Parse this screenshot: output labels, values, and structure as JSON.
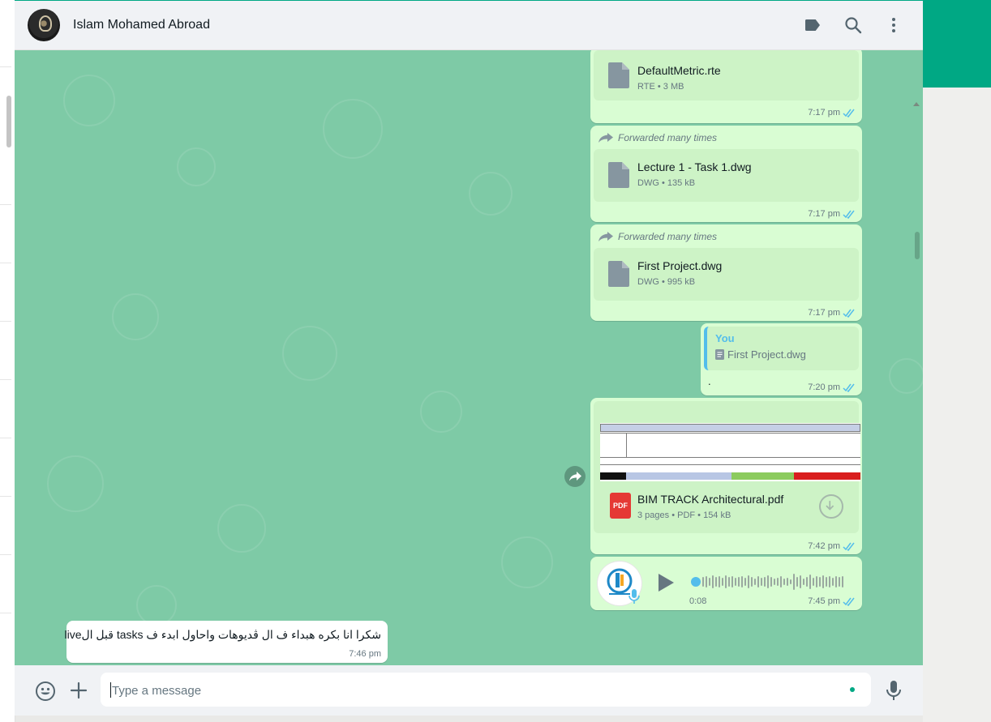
{
  "header": {
    "contact_name": "Islam Mohamed Abroad",
    "icons": [
      "label-icon",
      "search-icon",
      "menu-icon"
    ]
  },
  "messages": [
    {
      "type": "document",
      "direction": "out",
      "file_name": "DefaultMetric.rte",
      "meta": "RTE • 3 MB",
      "time": "7:17 pm",
      "status": "read"
    },
    {
      "type": "document",
      "direction": "out",
      "forwarded": "Forwarded many times",
      "file_name": "Lecture 1 - Task 1.dwg",
      "meta": "DWG • 135 kB",
      "time": "7:17 pm",
      "status": "read"
    },
    {
      "type": "document",
      "direction": "out",
      "forwarded": "Forwarded many times",
      "file_name": "First Project.dwg",
      "meta": "DWG • 995 kB",
      "time": "7:17 pm",
      "status": "read"
    },
    {
      "type": "reply",
      "direction": "out",
      "quote_author": "You",
      "quote_text": "First Project.dwg",
      "body": ".",
      "time": "7:20 pm",
      "status": "read"
    },
    {
      "type": "pdf",
      "direction": "out",
      "file_name": "BIM TRACK Architectural.pdf",
      "meta": "3 pages • PDF • 154 kB",
      "icon_label": "PDF",
      "time": "7:42 pm",
      "status": "read"
    },
    {
      "type": "voice",
      "direction": "out",
      "duration": "0:08",
      "time": "7:45 pm",
      "status": "read"
    },
    {
      "type": "text",
      "direction": "in",
      "body": "شكرا انا بكره هبداء ف ال ڤديوهات واحاول ابدء ف tasks قبل الlive",
      "time": "7:46 pm"
    }
  ],
  "composer": {
    "placeholder": "Type a message"
  },
  "colors": {
    "accent": "#00a884",
    "outgoing_bubble": "#d9fdd3",
    "chat_background": "#7ecaa6",
    "read_ticks": "#53bdeb"
  }
}
